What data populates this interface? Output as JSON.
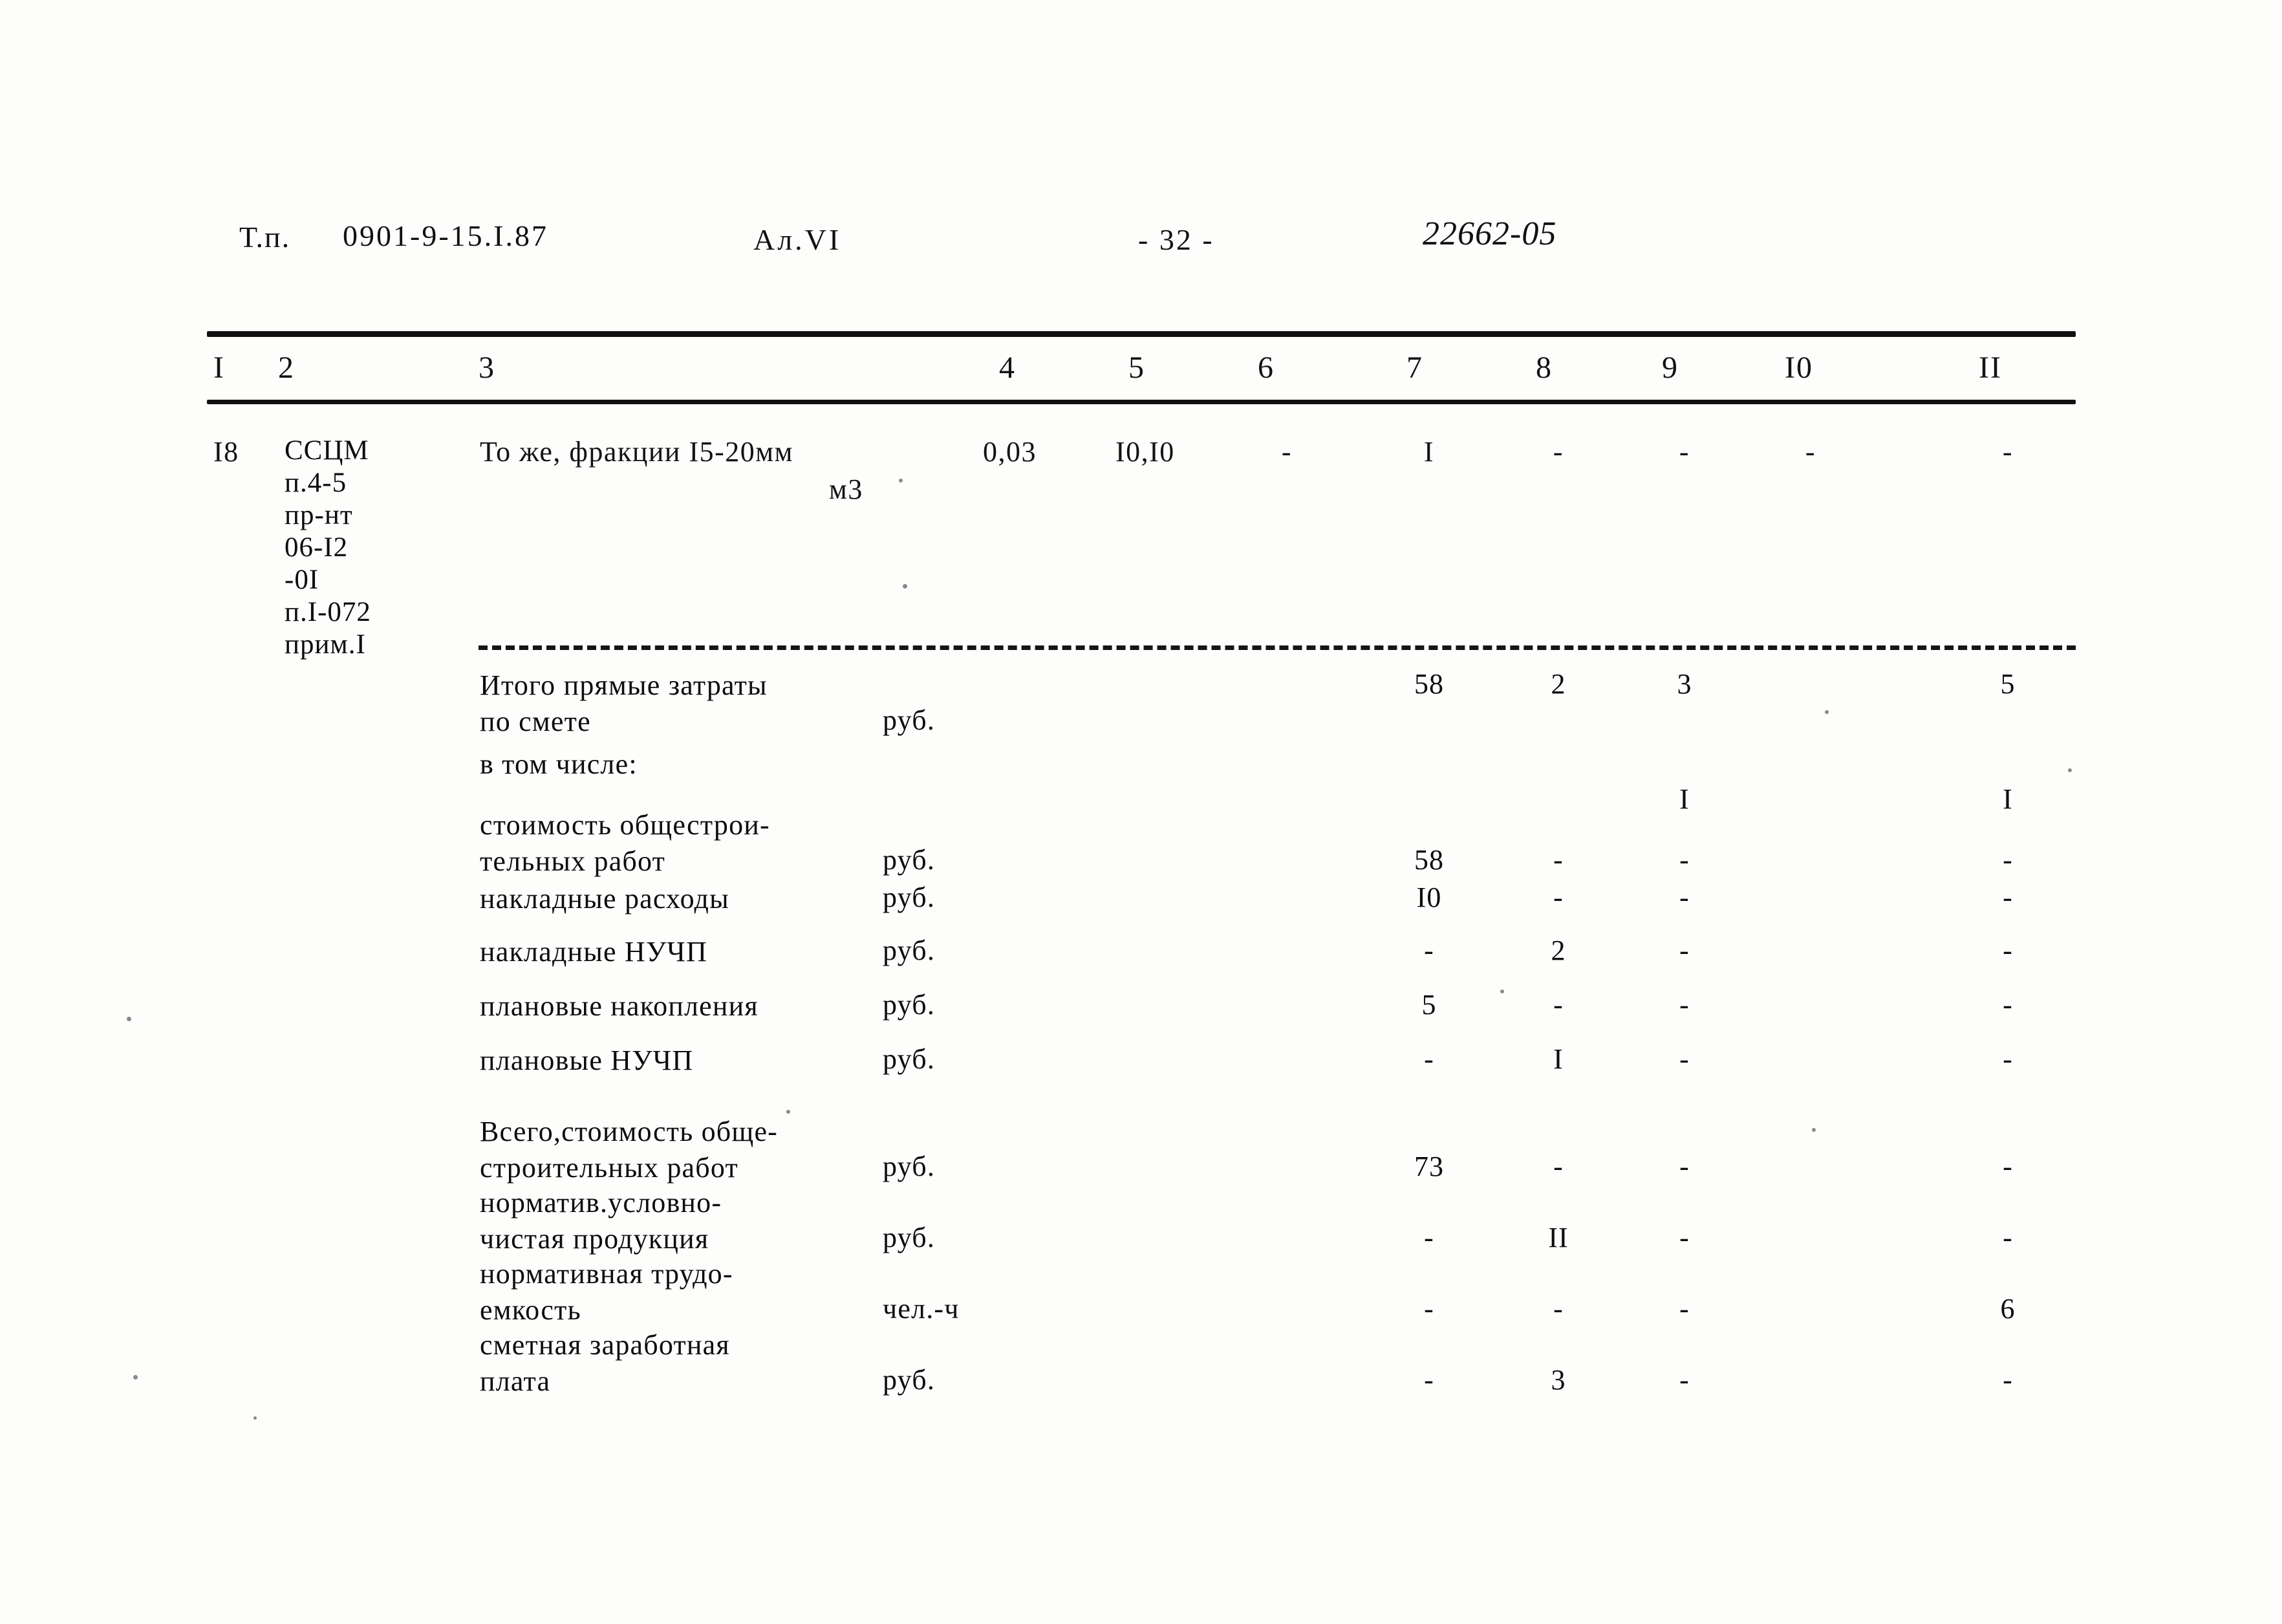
{
  "header": {
    "type_label": "Т.п.",
    "code": "0901-9-15.I.87",
    "album": "Ал.VI",
    "page": "- 32 -",
    "stamp": "22662-05"
  },
  "table": {
    "column_headers": [
      "I",
      "2",
      "3",
      "4",
      "5",
      "6",
      "7",
      "8",
      "9",
      "I0",
      "II"
    ],
    "item_row": {
      "num": "I8",
      "reference": "ССЦМ\nп.4-5\nпр-нт\n06-I2\n-0I\nп.I-072\nприм.I",
      "description": "То же, фракции I5-20мм",
      "unit": "м3",
      "c4": "0,03",
      "c5": "I0,I0",
      "c6": "-",
      "c7": "I",
      "c8": "-",
      "c9": "-",
      "c10": "-",
      "c11": "-"
    },
    "summary_rows": [
      {
        "label": "Итого прямые затраты\nпо смете",
        "unit": "руб.",
        "c7": "58",
        "c8": "2",
        "c9": "3",
        "c10": "",
        "c11": "5"
      },
      {
        "label": "в том числе:",
        "unit": "",
        "c7": "",
        "c8": "",
        "c9": "I",
        "c10": "",
        "c11": "I"
      },
      {
        "label": "стоимость общестрои-\nтельных работ",
        "unit": "руб.",
        "c7": "58",
        "c8": "-",
        "c9": "-",
        "c10": "",
        "c11": "-"
      },
      {
        "label": "накладные расходы",
        "unit": "руб.",
        "c7": "I0",
        "c8": "-",
        "c9": "-",
        "c10": "",
        "c11": "-"
      },
      {
        "label": "накладные НУЧП",
        "unit": "руб.",
        "c7": "-",
        "c8": "2",
        "c9": "-",
        "c10": "",
        "c11": "-"
      },
      {
        "label": "плановые накопления",
        "unit": "руб.",
        "c7": "5",
        "c8": "-",
        "c9": "-",
        "c10": "",
        "c11": "-"
      },
      {
        "label": "плановые НУЧП",
        "unit": "руб.",
        "c7": "-",
        "c8": "I",
        "c9": "-",
        "c10": "",
        "c11": "-"
      },
      {
        "label": "Всего,стоимость обще-\nстроительных работ",
        "unit": "руб.",
        "c7": "73",
        "c8": "-",
        "c9": "-",
        "c10": "",
        "c11": "-"
      },
      {
        "label": "норматив.условно-\nчистая продукция",
        "unit": "руб.",
        "c7": "-",
        "c8": "II",
        "c9": "-",
        "c10": "",
        "c11": "-"
      },
      {
        "label": "нормативная трудо-\nемкость",
        "unit": "чел.-ч",
        "c7": "-",
        "c8": "-",
        "c9": "-",
        "c10": "",
        "c11": "6"
      },
      {
        "label": "сметная заработная\nплата",
        "unit": "руб.",
        "c7": "-",
        "c8": "3",
        "c9": "-",
        "c10": "",
        "c11": "-"
      }
    ]
  }
}
